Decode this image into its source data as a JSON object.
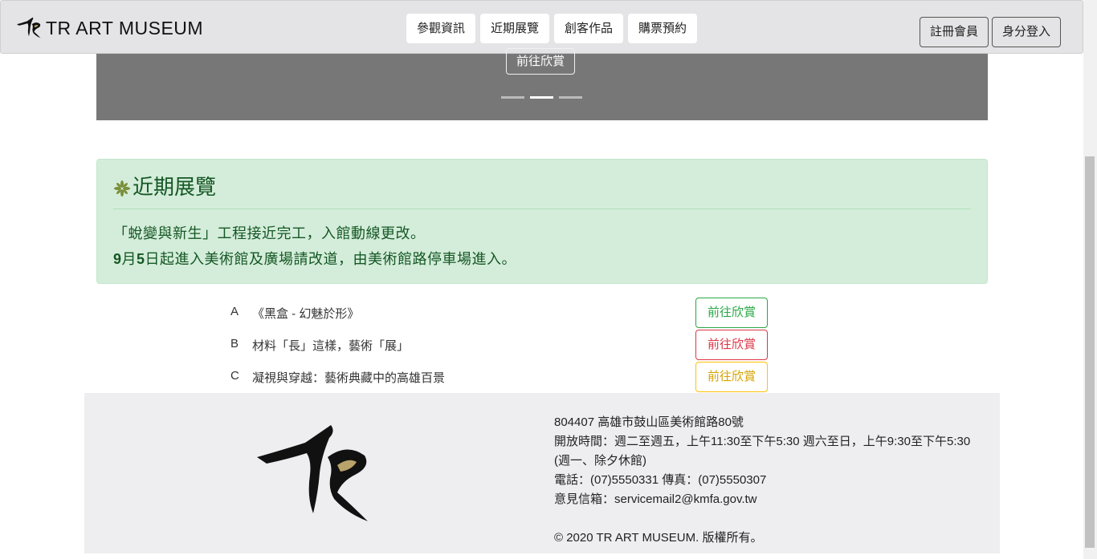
{
  "navbar": {
    "brand": "TR ART MUSEUM",
    "links": [
      "參觀資訊",
      "近期展覽",
      "創客作品",
      "購票預約"
    ],
    "register": "註冊會員",
    "login": "身分登入"
  },
  "carousel": {
    "cta": "前往欣賞",
    "active_slide": 2,
    "slide_count": 3
  },
  "alert": {
    "title": "近期展覽",
    "line1": "「蛻變與新生」工程接近完工，入館動線更改。",
    "line2_day1": "9",
    "line2_mid": "月",
    "line2_day2": "5",
    "line2_rest": "日起進入美術館及廣場請改道，由美術館路停車場進入。"
  },
  "exhibitions": [
    {
      "letter": "A",
      "title": "《黑盒 - 幻魅於形》",
      "button": "前往欣賞",
      "color": "#28a745"
    },
    {
      "letter": "B",
      "title": "材料「長」這樣，藝術「展」",
      "button": "前往欣賞",
      "color": "#dc3545"
    },
    {
      "letter": "C",
      "title": "凝視與穿越：藝術典藏中的高雄百景",
      "button": "前往欣賞",
      "color": "#ffc107"
    }
  ],
  "footer": {
    "address": "804407 高雄市鼓山區美術館路80號",
    "hours": "開放時間：週二至週五，上午11:30至下午5:30 週六至日，上午9:30至下午5:30 (週一、除夕休館)",
    "phone": "電話：(07)5550331 傳真：(07)5550307",
    "email": "意見信箱：servicemail2@kmfa.gov.tw",
    "copyright": "© 2020 TR ART MUSEUM. 版權所有。"
  },
  "colors": {
    "navbar_bg": "#e4e4e6",
    "carousel_bg": "#777777",
    "alert_bg": "#d4edda",
    "alert_text": "#155724",
    "footer_bg": "#eeeef1"
  }
}
